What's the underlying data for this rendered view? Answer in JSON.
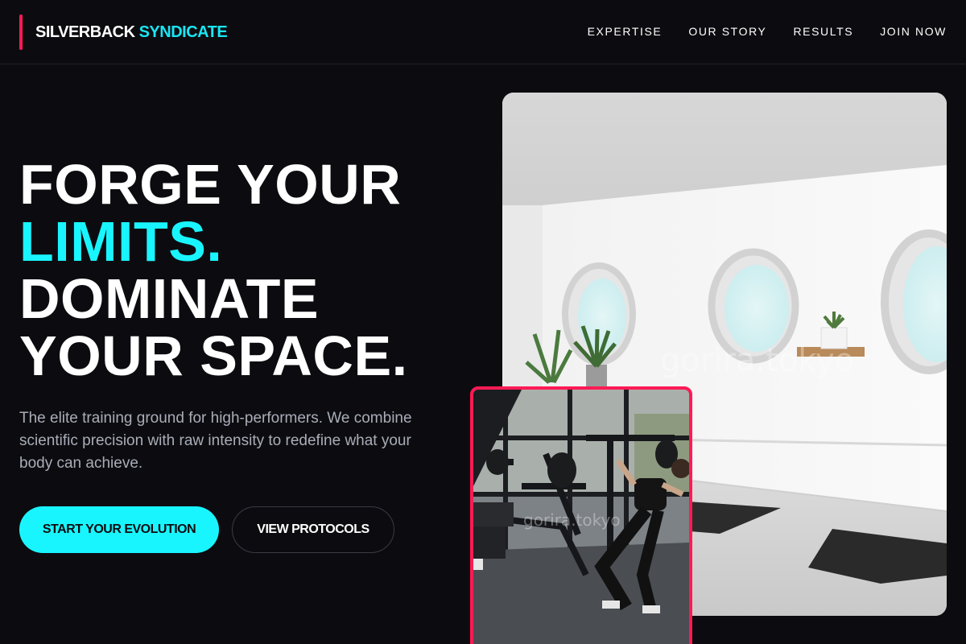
{
  "brand": {
    "name_part1": "SILVERBACK",
    "name_part2": "SYNDICATE",
    "accent_color": "#19f5ff",
    "highlight_color": "#ff1a55"
  },
  "nav": {
    "items": [
      {
        "label": "EXPERTISE"
      },
      {
        "label": "OUR STORY"
      },
      {
        "label": "RESULTS"
      },
      {
        "label": "JOIN NOW"
      }
    ]
  },
  "hero": {
    "title_line1": "FORGE YOUR",
    "title_line2": "LIMITS.",
    "title_line3": "DOMINATE",
    "title_line4": "YOUR SPACE.",
    "subtitle": "The elite training ground for high-performers. We combine scientific precision with raw intensity to redefine what your body can achieve.",
    "primary_cta": "START YOUR EVOLUTION",
    "secondary_cta": "VIEW PROTOCOLS"
  },
  "images": {
    "main_watermark": "gorira.tokyo",
    "small_watermark": "gorira.tokyo"
  }
}
